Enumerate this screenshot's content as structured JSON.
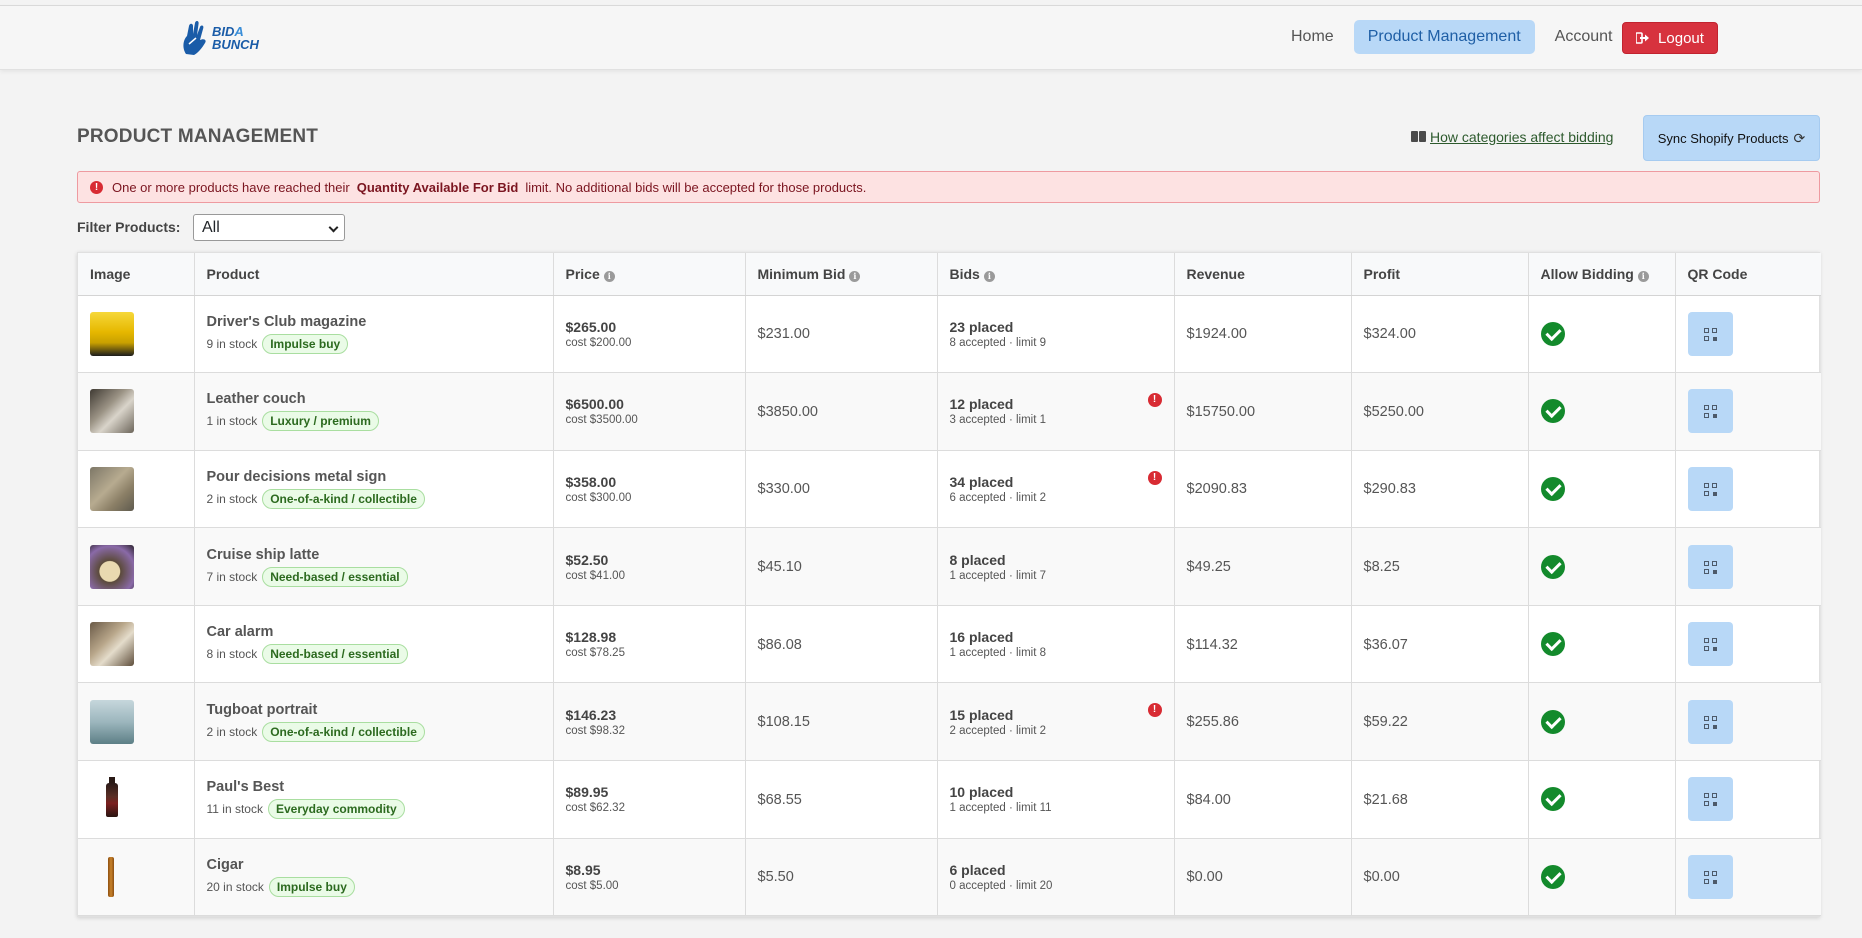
{
  "header": {
    "logo": {
      "line1": "BID",
      "line1_accent": "A",
      "line2": "BUNCH"
    },
    "nav": {
      "home": "Home",
      "product_management": "Product Management",
      "account": "Account"
    },
    "logout_label": "Logout"
  },
  "page": {
    "title": "PRODUCT MANAGEMENT",
    "help_link": "How categories affect bidding",
    "sync_button": "Sync Shopify Products"
  },
  "alert": {
    "prefix": "One or more products have reached their",
    "emphasis": "Quantity Available For Bid",
    "suffix": "limit. No additional bids will be accepted for those products."
  },
  "filter": {
    "label": "Filter Products:",
    "selected": "All"
  },
  "table": {
    "columns": {
      "image": "Image",
      "product": "Product",
      "price": "Price",
      "min_bid": "Minimum Bid",
      "bids": "Bids",
      "revenue": "Revenue",
      "profit": "Profit",
      "allow_bidding": "Allow Bidding",
      "qr": "QR Code"
    },
    "rows": [
      {
        "name": "Driver's Club magazine",
        "stock": "9 in stock",
        "category": "Impulse buy",
        "price": "$265.00",
        "cost": "cost $200.00",
        "min_bid": "$231.00",
        "bids": "23 placed",
        "bid_detail": "8 accepted · limit 9",
        "limit_warning": false,
        "revenue": "$1924.00",
        "profit": "$324.00",
        "allow": true
      },
      {
        "name": "Leather couch",
        "stock": "1 in stock",
        "category": "Luxury / premium",
        "price": "$6500.00",
        "cost": "cost $3500.00",
        "min_bid": "$3850.00",
        "bids": "12 placed",
        "bid_detail": "3 accepted · limit 1",
        "limit_warning": true,
        "revenue": "$15750.00",
        "profit": "$5250.00",
        "allow": true
      },
      {
        "name": "Pour decisions metal sign",
        "stock": "2 in stock",
        "category": "One-of-a-kind / collectible",
        "price": "$358.00",
        "cost": "cost $300.00",
        "min_bid": "$330.00",
        "bids": "34 placed",
        "bid_detail": "6 accepted · limit 2",
        "limit_warning": true,
        "revenue": "$2090.83",
        "profit": "$290.83",
        "allow": true
      },
      {
        "name": "Cruise ship latte",
        "stock": "7 in stock",
        "category": "Need-based / essential",
        "price": "$52.50",
        "cost": "cost $41.00",
        "min_bid": "$45.10",
        "bids": "8 placed",
        "bid_detail": "1 accepted · limit 7",
        "limit_warning": false,
        "revenue": "$49.25",
        "profit": "$8.25",
        "allow": true
      },
      {
        "name": "Car alarm",
        "stock": "8 in stock",
        "category": "Need-based / essential",
        "price": "$128.98",
        "cost": "cost $78.25",
        "min_bid": "$86.08",
        "bids": "16 placed",
        "bid_detail": "1 accepted · limit 8",
        "limit_warning": false,
        "revenue": "$114.32",
        "profit": "$36.07",
        "allow": true
      },
      {
        "name": "Tugboat portrait",
        "stock": "2 in stock",
        "category": "One-of-a-kind / collectible",
        "price": "$146.23",
        "cost": "cost $98.32",
        "min_bid": "$108.15",
        "bids": "15 placed",
        "bid_detail": "2 accepted · limit 2",
        "limit_warning": true,
        "revenue": "$255.86",
        "profit": "$59.22",
        "allow": true
      },
      {
        "name": "Paul's Best",
        "stock": "11 in stock",
        "category": "Everyday commodity",
        "price": "$89.95",
        "cost": "cost $62.32",
        "min_bid": "$68.55",
        "bids": "10 placed",
        "bid_detail": "1 accepted · limit 11",
        "limit_warning": false,
        "revenue": "$84.00",
        "profit": "$21.68",
        "allow": true
      },
      {
        "name": "Cigar",
        "stock": "20 in stock",
        "category": "Impulse buy",
        "price": "$8.95",
        "cost": "cost $5.00",
        "min_bid": "$5.50",
        "bids": "6 placed",
        "bid_detail": "0 accepted · limit 20",
        "limit_warning": false,
        "revenue": "$0.00",
        "profit": "$0.00",
        "allow": true
      }
    ]
  },
  "colors": {
    "primary_light": "#b8d8f7",
    "danger": "#d7323e",
    "success": "#138a2c",
    "alert_bg": "#fde2e2"
  }
}
